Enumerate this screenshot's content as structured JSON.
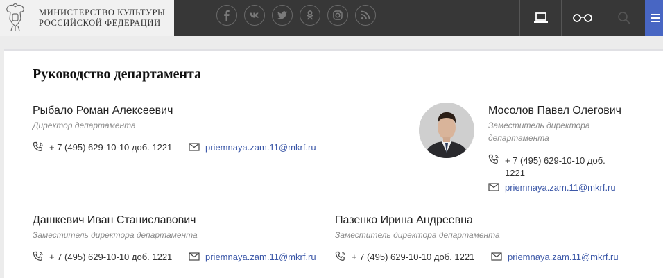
{
  "header": {
    "ministry_line1": "Министерство культуры",
    "ministry_line2": "Российской Федерации",
    "socials": [
      "facebook-icon",
      "vk-icon",
      "twitter-icon",
      "odnoklassniki-icon",
      "instagram-icon",
      "rss-icon"
    ],
    "buttons": [
      "laptop-icon",
      "glasses-icon",
      "search-icon",
      "menu-icon"
    ],
    "colors": {
      "header_bg": "#373737",
      "menu_accent": "#4866c3",
      "link": "#3c58a8"
    }
  },
  "section": {
    "title": "Руководство департамента"
  },
  "people": [
    {
      "name": "Рыбало Роман Алексеевич",
      "role": "Директор департамента",
      "phone": "+ 7 (495) 629-10-10 доб. 1221",
      "email": "priemnaya.zam.11@mkrf.ru"
    },
    {
      "name": "Мосолов Павел Олегович",
      "role_line1": "Заместитель директора",
      "role_line2": "департамента",
      "phone_line1": "+ 7 (495) 629-10-10 доб.",
      "phone_line2": "1221",
      "email": "priemnaya.zam.11@mkrf.ru"
    },
    {
      "name": "Дашкевич Иван Станиславович",
      "role": "Заместитель директора департамента",
      "phone": "+ 7 (495) 629-10-10 доб. 1221",
      "email": "priemnaya.zam.11@mkrf.ru"
    },
    {
      "name": "Пазенко Ирина Андреевна",
      "role": "Заместитель директора департамента",
      "phone": "+ 7 (495) 629-10-10 доб. 1221",
      "email": "priemnaya.zam.11@mkrf.ru"
    }
  ]
}
